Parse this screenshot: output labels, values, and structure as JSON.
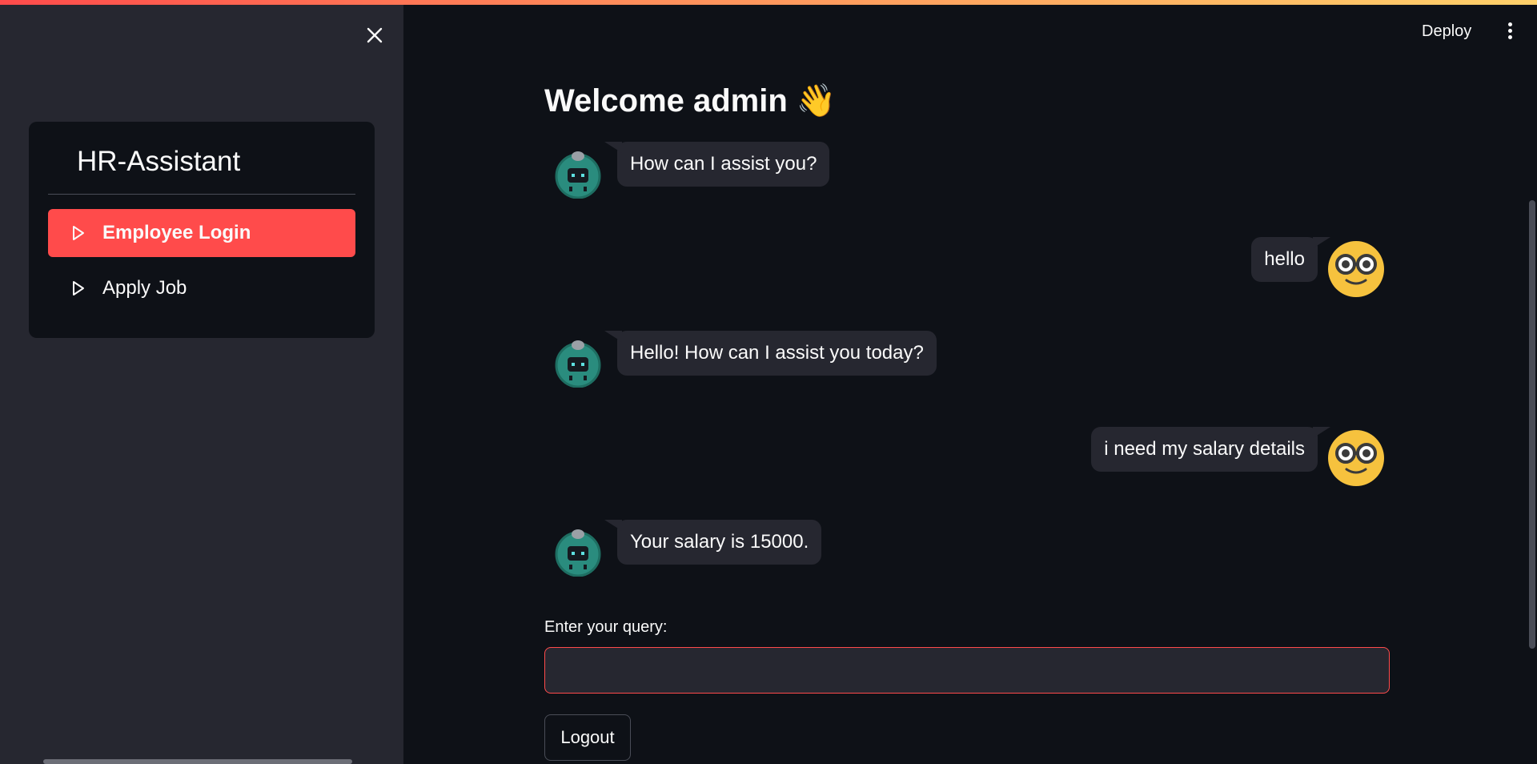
{
  "sidebar": {
    "title": "HR-Assistant",
    "close_icon": "close-icon",
    "items": [
      {
        "label": "Employee Login",
        "icon": "play-outline-icon",
        "active": true
      },
      {
        "label": "Apply Job",
        "icon": "play-outline-icon",
        "active": false
      }
    ]
  },
  "header": {
    "deploy_label": "Deploy",
    "menu_icon": "kebab-menu-icon"
  },
  "main": {
    "welcome": "Welcome admin 👋",
    "messages": [
      {
        "role": "assistant",
        "avatar": "robot-avatar-icon",
        "text": "How can I assist you?"
      },
      {
        "role": "user",
        "avatar": "nerd-face-avatar-icon",
        "text": "hello"
      },
      {
        "role": "assistant",
        "avatar": "robot-avatar-icon",
        "text": "Hello! How can I assist you today?"
      },
      {
        "role": "user",
        "avatar": "nerd-face-avatar-icon",
        "text": "i need my salary details"
      },
      {
        "role": "assistant",
        "avatar": "robot-avatar-icon",
        "text": "Your salary is 15000."
      }
    ],
    "query_label": "Enter your query:",
    "query_value": "",
    "logout_label": "Logout"
  },
  "colors": {
    "accent": "#ff4b4b",
    "background": "#0e1117",
    "sidebar_bg": "#262730",
    "bubble_bg": "#262730"
  }
}
